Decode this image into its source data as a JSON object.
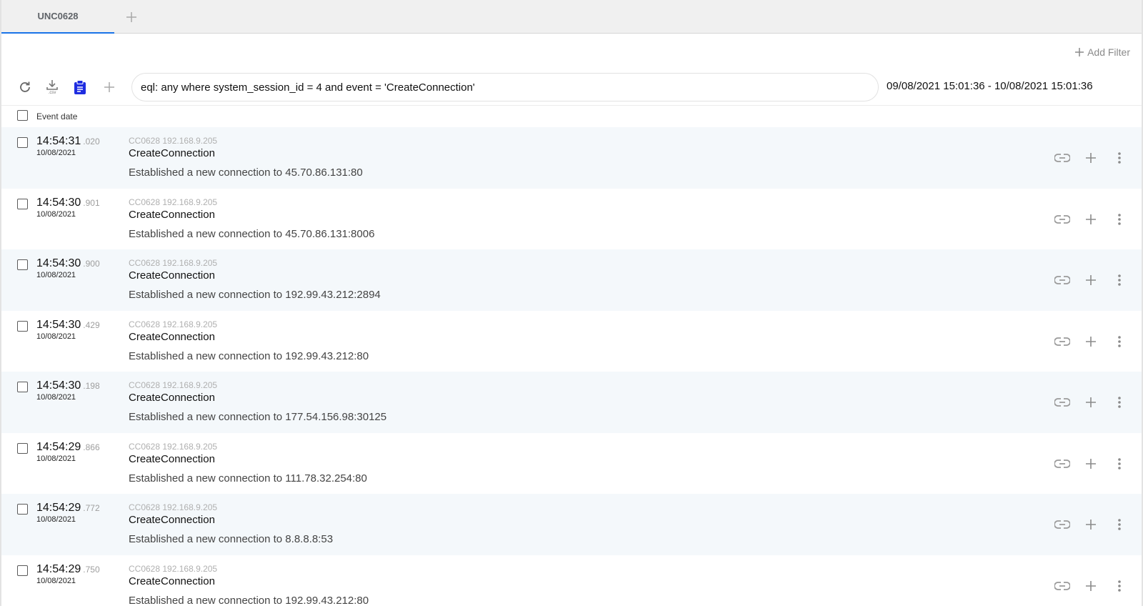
{
  "tabs": [
    {
      "label": "UNC0628",
      "active": true
    }
  ],
  "add_filter_label": "Add Filter",
  "toolbar": {
    "csv_label": ".csv",
    "query": "eql: any where system_session_id = 4 and event = 'CreateConnection'",
    "date_range": "09/08/2021 15:01:36 - 10/08/2021 15:01:36"
  },
  "table": {
    "header": "Event date",
    "rows": [
      {
        "time": "14:54:31",
        "ms": ".020",
        "date": "10/08/2021",
        "host": "CC0628 192.168.9.205",
        "event": "CreateConnection",
        "desc": "Established a new connection to 45.70.86.131:80"
      },
      {
        "time": "14:54:30",
        "ms": ".901",
        "date": "10/08/2021",
        "host": "CC0628 192.168.9.205",
        "event": "CreateConnection",
        "desc": "Established a new connection to 45.70.86.131:8006"
      },
      {
        "time": "14:54:30",
        "ms": ".900",
        "date": "10/08/2021",
        "host": "CC0628 192.168.9.205",
        "event": "CreateConnection",
        "desc": "Established a new connection to 192.99.43.212:2894"
      },
      {
        "time": "14:54:30",
        "ms": ".429",
        "date": "10/08/2021",
        "host": "CC0628 192.168.9.205",
        "event": "CreateConnection",
        "desc": "Established a new connection to 192.99.43.212:80"
      },
      {
        "time": "14:54:30",
        "ms": ".198",
        "date": "10/08/2021",
        "host": "CC0628 192.168.9.205",
        "event": "CreateConnection",
        "desc": "Established a new connection to 177.54.156.98:30125"
      },
      {
        "time": "14:54:29",
        "ms": ".866",
        "date": "10/08/2021",
        "host": "CC0628 192.168.9.205",
        "event": "CreateConnection",
        "desc": "Established a new connection to 111.78.32.254:80"
      },
      {
        "time": "14:54:29",
        "ms": ".772",
        "date": "10/08/2021",
        "host": "CC0628 192.168.9.205",
        "event": "CreateConnection",
        "desc": "Established a new connection to 8.8.8.8:53"
      },
      {
        "time": "14:54:29",
        "ms": ".750",
        "date": "10/08/2021",
        "host": "CC0628 192.168.9.205",
        "event": "CreateConnection",
        "desc": "Established a new connection to 192.99.43.212:80"
      }
    ]
  },
  "icons": {
    "refresh": "refresh-icon",
    "download": "download-csv-icon",
    "clipboard": "clipboard-icon",
    "add": "plus-icon",
    "link": "link-icon",
    "more": "more-vertical-icon"
  },
  "colors": {
    "accent": "#1a73e8",
    "clipboard": "#1f2de0",
    "row_alt": "#f4f8fb",
    "icon_gray": "#9a9a9a"
  }
}
